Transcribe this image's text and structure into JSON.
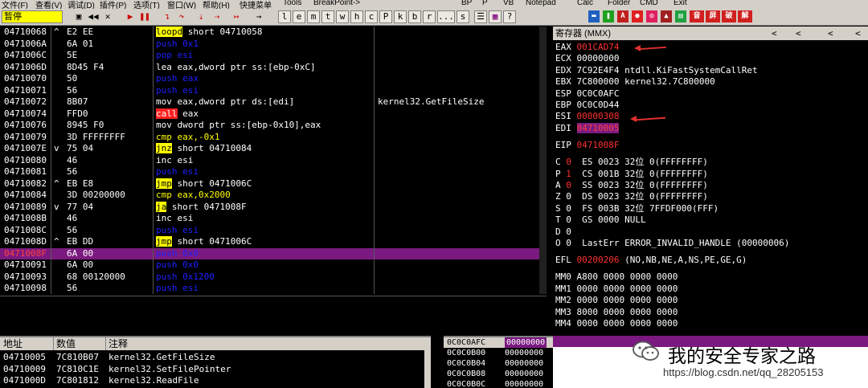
{
  "menubar": {
    "items": [
      "文件(F)",
      "查看(V)",
      "调试(D)",
      "插件(P)",
      "选项(T)",
      "窗口(W)",
      "帮助(H)",
      "快捷菜单",
      "Tools",
      "BreakPoint->"
    ],
    "tabs": [
      "BP",
      "P",
      "VB",
      "Notepad",
      "Calc",
      "Folder",
      "CMD",
      "Exit"
    ]
  },
  "toolbar": {
    "status": "暂停",
    "letters": [
      "l",
      "e",
      "m",
      "t",
      "w",
      "h",
      "c",
      "P",
      "k",
      "b",
      "r",
      "...",
      "s"
    ]
  },
  "disasm": {
    "rows": [
      {
        "addr": "04710068",
        "jmp": "^",
        "hex": "E2 EE",
        "ins": [
          {
            "t": "loopd",
            "c": "kw-yellow"
          },
          {
            "t": " short 04710058",
            "c": "op"
          }
        ]
      },
      {
        "addr": "0471006A",
        "jmp": "",
        "hex": "6A 01",
        "ins": [
          {
            "t": "push 0x1",
            "c": "blue"
          }
        ]
      },
      {
        "addr": "0471006C",
        "jmp": "",
        "hex": "5E",
        "ins": [
          {
            "t": "pop esi",
            "c": "blue"
          }
        ]
      },
      {
        "addr": "0471006D",
        "jmp": "",
        "hex": "8D45 F4",
        "ins": [
          {
            "t": "lea eax,dword ptr ss:[ebp-0xC]",
            "c": "op"
          }
        ]
      },
      {
        "addr": "04710070",
        "jmp": "",
        "hex": "50",
        "ins": [
          {
            "t": "push eax",
            "c": "blue"
          }
        ]
      },
      {
        "addr": "04710071",
        "jmp": "",
        "hex": "56",
        "ins": [
          {
            "t": "push esi",
            "c": "blue"
          }
        ]
      },
      {
        "addr": "04710072",
        "jmp": "",
        "hex": "8B07",
        "ins": [
          {
            "t": "mov eax,dword ptr ds:[edi]",
            "c": "op"
          }
        ],
        "cmt": "kernel32.GetFileSize"
      },
      {
        "addr": "04710074",
        "jmp": "",
        "hex": "FFD0",
        "ins": [
          {
            "t": "call",
            "c": "kw-red"
          },
          {
            "t": " eax",
            "c": "op"
          }
        ]
      },
      {
        "addr": "04710076",
        "jmp": "",
        "hex": "8945 F0",
        "ins": [
          {
            "t": "mov dword ptr ss:[ebp-0x10],eax",
            "c": "op"
          }
        ]
      },
      {
        "addr": "04710079",
        "jmp": "",
        "hex": "3D FFFFFFFF",
        "ins": [
          {
            "t": "cmp eax,-0x1",
            "c": "num"
          }
        ]
      },
      {
        "addr": "0471007E",
        "jmp": "v",
        "hex": "75 04",
        "ins": [
          {
            "t": "jnz",
            "c": "kw-yellow"
          },
          {
            "t": " short 04710084",
            "c": "op"
          }
        ]
      },
      {
        "addr": "04710080",
        "jmp": "",
        "hex": "46",
        "ins": [
          {
            "t": "inc esi",
            "c": "op"
          }
        ]
      },
      {
        "addr": "04710081",
        "jmp": "",
        "hex": "56",
        "ins": [
          {
            "t": "push esi",
            "c": "blue"
          }
        ]
      },
      {
        "addr": "04710082",
        "jmp": "^",
        "hex": "EB E8",
        "ins": [
          {
            "t": "jmp",
            "c": "kw-yellow"
          },
          {
            "t": " short 0471006C",
            "c": "op"
          }
        ]
      },
      {
        "addr": "04710084",
        "jmp": "",
        "hex": "3D 00200000",
        "ins": [
          {
            "t": "cmp eax,0x2000",
            "c": "num"
          }
        ]
      },
      {
        "addr": "04710089",
        "jmp": "v",
        "hex": "77 04",
        "ins": [
          {
            "t": "ja",
            "c": "kw-yellow"
          },
          {
            "t": " short 0471008F",
            "c": "op"
          }
        ]
      },
      {
        "addr": "0471008B",
        "jmp": "",
        "hex": "46",
        "ins": [
          {
            "t": "inc esi",
            "c": "op"
          }
        ]
      },
      {
        "addr": "0471008C",
        "jmp": "",
        "hex": "56",
        "ins": [
          {
            "t": "push esi",
            "c": "blue"
          }
        ]
      },
      {
        "addr": "0471008D",
        "jmp": "^",
        "hex": "EB DD",
        "ins": [
          {
            "t": "jmp",
            "c": "kw-yellow"
          },
          {
            "t": " short 0471006C",
            "c": "op"
          }
        ]
      },
      {
        "addr": "0471008F",
        "jmp": "",
        "hex": "6A 00",
        "ins": [
          {
            "t": "push 0x0",
            "c": "blue"
          }
        ],
        "sel": true
      },
      {
        "addr": "04710091",
        "jmp": "",
        "hex": "6A 00",
        "ins": [
          {
            "t": "push 0x0",
            "c": "blue"
          }
        ]
      },
      {
        "addr": "04710093",
        "jmp": "",
        "hex": "68 00120000",
        "ins": [
          {
            "t": "push 0x1200",
            "c": "blue"
          }
        ]
      },
      {
        "addr": "04710098",
        "jmp": "",
        "hex": "56",
        "ins": [
          {
            "t": "push esi",
            "c": "blue"
          }
        ]
      }
    ]
  },
  "registers": {
    "title": "寄存器 (MMX)",
    "lines": [
      {
        "n": "EAX",
        "v": "001CAD74",
        "vc": "red",
        "r": ""
      },
      {
        "n": "ECX",
        "v": "00000000",
        "vc": "",
        "r": ""
      },
      {
        "n": "EDX",
        "v": "7C92E4F4",
        "vc": "",
        "r": "ntdll.KiFastSystemCallRet"
      },
      {
        "n": "EBX",
        "v": "7C800000",
        "vc": "",
        "r": "kernel32.7C800000"
      },
      {
        "n": "ESP",
        "v": "0C0C0AFC",
        "vc": "",
        "r": ""
      },
      {
        "n": "EBP",
        "v": "0C0C0D44",
        "vc": "",
        "r": ""
      },
      {
        "n": "ESI",
        "v": "00000308",
        "vc": "red",
        "r": ""
      },
      {
        "n": "EDI",
        "v": "04710005",
        "vc": "hl",
        "r": ""
      }
    ],
    "eip": {
      "n": "EIP",
      "v": "0471008F"
    },
    "flags": [
      {
        "f": "C",
        "b": "0",
        "bc": "red",
        "seg": "ES 0023 32位 0(FFFFFFFF)"
      },
      {
        "f": "P",
        "b": "1",
        "bc": "red",
        "seg": "CS 001B 32位 0(FFFFFFFF)"
      },
      {
        "f": "A",
        "b": "0",
        "bc": "red",
        "seg": "SS 0023 32位 0(FFFFFFFF)"
      },
      {
        "f": "Z",
        "b": "0",
        "bc": "",
        "seg": "DS 0023 32位 0(FFFFFFFF)"
      },
      {
        "f": "S",
        "b": "0",
        "bc": "",
        "seg": "FS 003B 32位 7FFDF000(FFF)"
      },
      {
        "f": "T",
        "b": "0",
        "bc": "",
        "seg": "GS 0000 NULL"
      },
      {
        "f": "D",
        "b": "0",
        "bc": "",
        "seg": ""
      },
      {
        "f": "O",
        "b": "0",
        "bc": "",
        "seg": "LastErr ERROR_INVALID_HANDLE (00000006)"
      }
    ],
    "efl": {
      "n": "EFL",
      "v": "00200206",
      "r": "(NO,NB,NE,A,NS,PE,GE,G)"
    },
    "mmx": [
      "MM0 A800 0000 0000 0000",
      "MM1 0000 0000 0000 0000",
      "MM2 0000 0000 0000 0000",
      "MM3 8000 0000 0000 0000",
      "MM4 0000 0000 0000 0000"
    ]
  },
  "dump": {
    "headers": [
      "地址",
      "数值",
      "注释"
    ],
    "rows": [
      {
        "a": "04710005",
        "v": "7C810B07",
        "c": "kernel32.GetFileSize"
      },
      {
        "a": "04710009",
        "v": "7C810C1E",
        "c": "kernel32.SetFilePointer"
      },
      {
        "a": "0471000D",
        "v": "7C801812",
        "c": "kernel32.ReadFile"
      }
    ]
  },
  "stack": {
    "rows": [
      {
        "a": "0C0C0AFC",
        "v": "00000000",
        "sel": true
      },
      {
        "a": "0C0C0B00",
        "v": "00000000"
      },
      {
        "a": "0C0C0B04",
        "v": "00000000"
      },
      {
        "a": "0C0C0B08",
        "v": "00000000"
      },
      {
        "a": "0C0C0B0C",
        "v": "00000000"
      }
    ]
  },
  "watermark": {
    "text": "我的安全专家之路",
    "url": "https://blog.csdn.net/qq_28205153"
  }
}
